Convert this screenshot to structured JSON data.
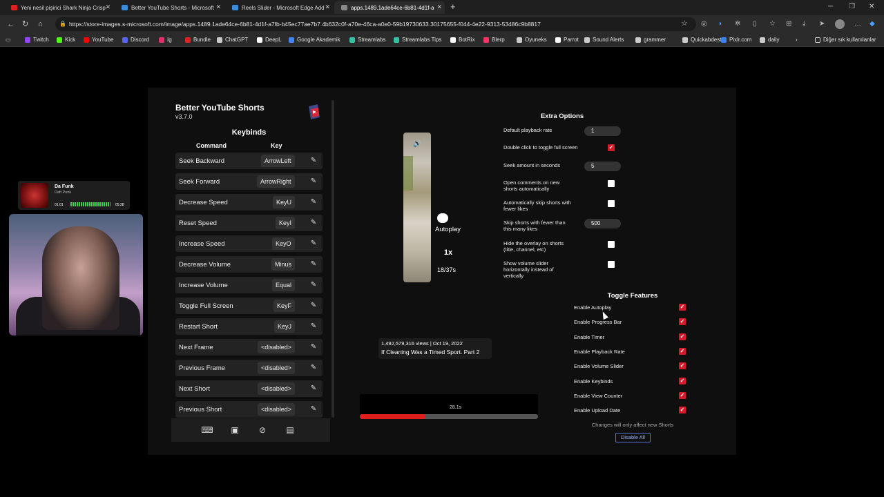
{
  "browser": {
    "tabs": [
      {
        "title": "Yeni nesil pişirici Shark Ninja Crisp",
        "favicon_color": "#e02020"
      },
      {
        "title": "Better YouTube Shorts - Microsoft",
        "favicon_color": "#3a8dde"
      },
      {
        "title": "Reels Slider - Microsoft Edge Add",
        "favicon_color": "#3a8dde"
      },
      {
        "title": "apps.1489.1ade64ce-6b81-4d1f-a",
        "favicon_color": "#888888"
      }
    ],
    "url": "https://store-images.s-microsoft.com/image/apps.1489.1ade64ce-6b81-4d1f-a7fb-b45ec77ae7b7.4b632c0f-a70e-46ca-a0e0-59b19730633.30175655-f044-4e22-9313-53486c9b8817",
    "bookmarks": [
      {
        "label": "Twitch",
        "color": "#9146ff"
      },
      {
        "label": "Kick",
        "color": "#53fc18"
      },
      {
        "label": "YouTube",
        "color": "#ff0000"
      },
      {
        "label": "Discord",
        "color": "#5865f2"
      },
      {
        "label": "Ig",
        "color": "#e1306c"
      },
      {
        "label": "Bundle",
        "color": "#d22"
      },
      {
        "label": "ChatGPT",
        "color": "#cccccc"
      },
      {
        "label": "DeepL",
        "color": "#ffffff"
      },
      {
        "label": "Google Akademik",
        "color": "#4285f4"
      },
      {
        "label": "Streamlabs",
        "color": "#31c3a2"
      },
      {
        "label": "Streamlabs Tips",
        "color": "#31c3a2"
      },
      {
        "label": "BotRix",
        "color": "#ffffff"
      },
      {
        "label": "Blerp",
        "color": "#ff3366"
      },
      {
        "label": "Oyuneks",
        "color": "#cccccc"
      },
      {
        "label": "Parrot",
        "color": "#ffffff"
      },
      {
        "label": "Sound Alerts",
        "color": "#cccccc"
      },
      {
        "label": "grammer",
        "color": "#cccccc"
      },
      {
        "label": "Quickabdest",
        "color": "#cccccc"
      },
      {
        "label": "Pixlr.com",
        "color": "#3b82f6"
      },
      {
        "label": "daily",
        "color": "#cccccc"
      }
    ],
    "other_bookmarks": "Diğer sık kullanılanlar"
  },
  "music": {
    "title": "Da Funk",
    "artist": "Daft Punk",
    "elapsed": "01:01",
    "total": "05:28"
  },
  "extension": {
    "title": "Better YouTube Shorts",
    "version": "v3.7.0",
    "keybinds_heading": "Keybinds",
    "col_command": "Command",
    "col_key": "Key",
    "keybinds": [
      {
        "command": "Seek Backward",
        "key": "ArrowLeft"
      },
      {
        "command": "Seek Forward",
        "key": "ArrowRight"
      },
      {
        "command": "Decrease Speed",
        "key": "KeyU"
      },
      {
        "command": "Reset Speed",
        "key": "KeyI"
      },
      {
        "command": "Increase Speed",
        "key": "KeyO"
      },
      {
        "command": "Decrease Volume",
        "key": "Minus"
      },
      {
        "command": "Increase Volume",
        "key": "Equal"
      },
      {
        "command": "Toggle Full Screen",
        "key": "KeyF"
      },
      {
        "command": "Restart Short",
        "key": "KeyJ"
      },
      {
        "command": "Next Frame",
        "key": "<disabled>"
      },
      {
        "command": "Previous Frame",
        "key": "<disabled>"
      },
      {
        "command": "Next Short",
        "key": "<disabled>"
      },
      {
        "command": "Previous Short",
        "key": "<disabled>"
      }
    ]
  },
  "preview": {
    "autoplay_label": "Autoplay",
    "speed": "1x",
    "timer": "18/37s",
    "views": "1,492,579,316 views | Oct 19, 2022",
    "video_title": "If Cleaning Was a Timed Sport. Part 2",
    "progress_time": "28.1s",
    "progress_fraction": 0.37
  },
  "extra_options": {
    "heading": "Extra Options",
    "items": [
      {
        "label": "Default playback rate",
        "type": "input",
        "value": "1"
      },
      {
        "label": "Double click to toggle full screen",
        "type": "check",
        "checked": true
      },
      {
        "label": "Seek amount in seconds",
        "type": "input",
        "value": "5"
      },
      {
        "label": "Open comments on new shorts automatically",
        "type": "check",
        "checked": false
      },
      {
        "label": "Automatically skip shorts with fewer likes",
        "type": "check",
        "checked": false
      },
      {
        "label": "Skip shorts with fewer than this many likes",
        "type": "input",
        "value": "500"
      },
      {
        "label": "Hide the overlay on shorts (title, channel, etc)",
        "type": "check",
        "checked": false
      },
      {
        "label": "Show volume slider horizontally instead of vertically",
        "type": "check",
        "checked": false
      }
    ]
  },
  "toggle_features": {
    "heading": "Toggle Features",
    "items": [
      {
        "label": "Enable Autoplay",
        "checked": true
      },
      {
        "label": "Enable Progress Bar",
        "checked": true
      },
      {
        "label": "Enable Timer",
        "checked": true
      },
      {
        "label": "Enable Playback Rate",
        "checked": true
      },
      {
        "label": "Enable Volume Slider",
        "checked": true
      },
      {
        "label": "Enable Keybinds",
        "checked": true
      },
      {
        "label": "Enable View Counter",
        "checked": true
      },
      {
        "label": "Enable Upload Date",
        "checked": true
      }
    ],
    "note": "Changes will only affect new Shorts",
    "disable_all": "Disable All"
  },
  "icons": {
    "volume": "volume-icon",
    "edit": "pencil-icon",
    "check": "✓"
  },
  "colors": {
    "accent_red": "#d41b2c",
    "progress_red": "#e01e1e",
    "link_blue": "#9fb4ff"
  }
}
